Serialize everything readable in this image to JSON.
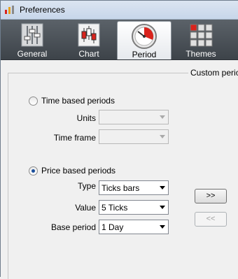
{
  "window": {
    "title": "Preferences"
  },
  "toolbar": {
    "items": [
      {
        "label": "General",
        "icon": "sliders-icon",
        "active": false
      },
      {
        "label": "Chart",
        "icon": "candlestick-chart-icon",
        "active": false
      },
      {
        "label": "Period",
        "icon": "clock-icon",
        "active": true
      },
      {
        "label": "Themes",
        "icon": "grid-icon",
        "active": false
      }
    ]
  },
  "custom_period": {
    "legend": "Custom period",
    "time_based": {
      "label": "Time based periods",
      "selected": false,
      "units_label": "Units",
      "units_value": "",
      "timeframe_label": "Time frame",
      "timeframe_value": ""
    },
    "price_based": {
      "label": "Price based periods",
      "selected": true,
      "type_label": "Type",
      "type_value": "Ticks bars",
      "value_label": "Value",
      "value_value": "5 Ticks",
      "base_label": "Base period",
      "base_value": "1 Day"
    },
    "add_button": ">>",
    "remove_button": "<<"
  },
  "colors": {
    "toolbar": "#4b5258",
    "accent": "#d9231c",
    "radio_dot": "#1a4f9c"
  }
}
